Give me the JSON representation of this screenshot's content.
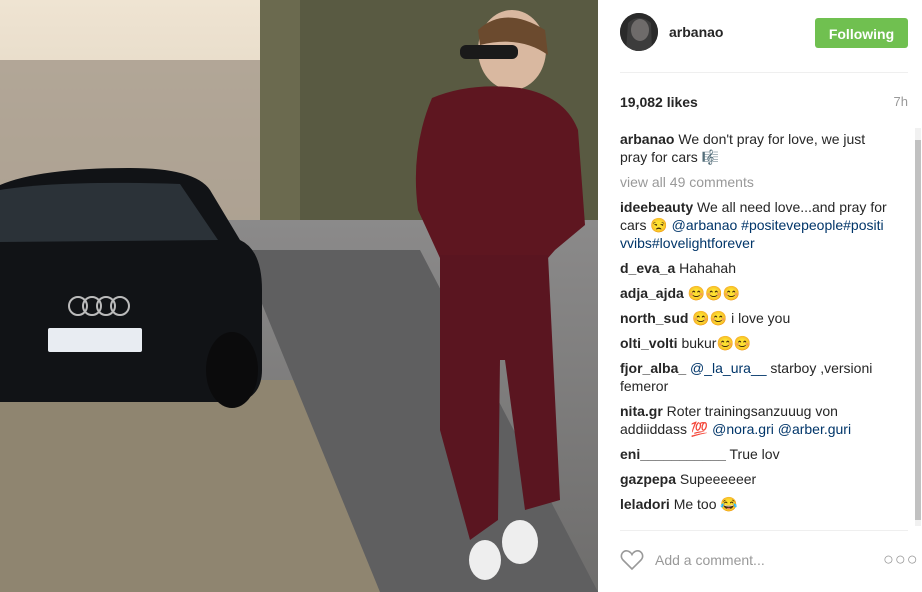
{
  "post": {
    "username": "arbanao",
    "follow_label": "Following",
    "likes": "19,082 likes",
    "time": "7h",
    "caption_user": "arbanao",
    "caption_text": "We don't pray for love, we just pray for cars 🎼",
    "view_all": "view all 49 comments",
    "add_comment_placeholder": "Add a comment...",
    "more_label": "○○○"
  },
  "comments": [
    {
      "user": "ideebeauty",
      "text": "We all need love...and pray for cars 😒 ",
      "mention": "@arbanao #positevepeople#positivvibs#lovelightforever"
    },
    {
      "user": "d_eva_a",
      "text": "Hahahah",
      "mention": ""
    },
    {
      "user": "adja_ajda",
      "text": "😊😊😊",
      "mention": ""
    },
    {
      "user": "north_sud",
      "text": "😊😊 i love you",
      "mention": ""
    },
    {
      "user": "olti_volti",
      "text": "bukur😊😊",
      "mention": ""
    },
    {
      "user": "fjor_alba_",
      "text": "",
      "mention": "@_la_ura__",
      "text2": " starboy ,versioni femeror"
    },
    {
      "user": "nita.gr",
      "text": "Roter trainingsanzuuug von addiiddass 💯 ",
      "mention": "@nora.gri @arber.guri"
    },
    {
      "user": "eni___________",
      "text": "True lov",
      "mention": ""
    },
    {
      "user": "gazpepa",
      "text": "Supeeeeeer",
      "mention": ""
    },
    {
      "user": "leladori",
      "text": "Me too 😂",
      "mention": ""
    }
  ],
  "colors": {
    "follow_bg": "#70c050",
    "mention": "#003569",
    "muted": "#999999"
  }
}
